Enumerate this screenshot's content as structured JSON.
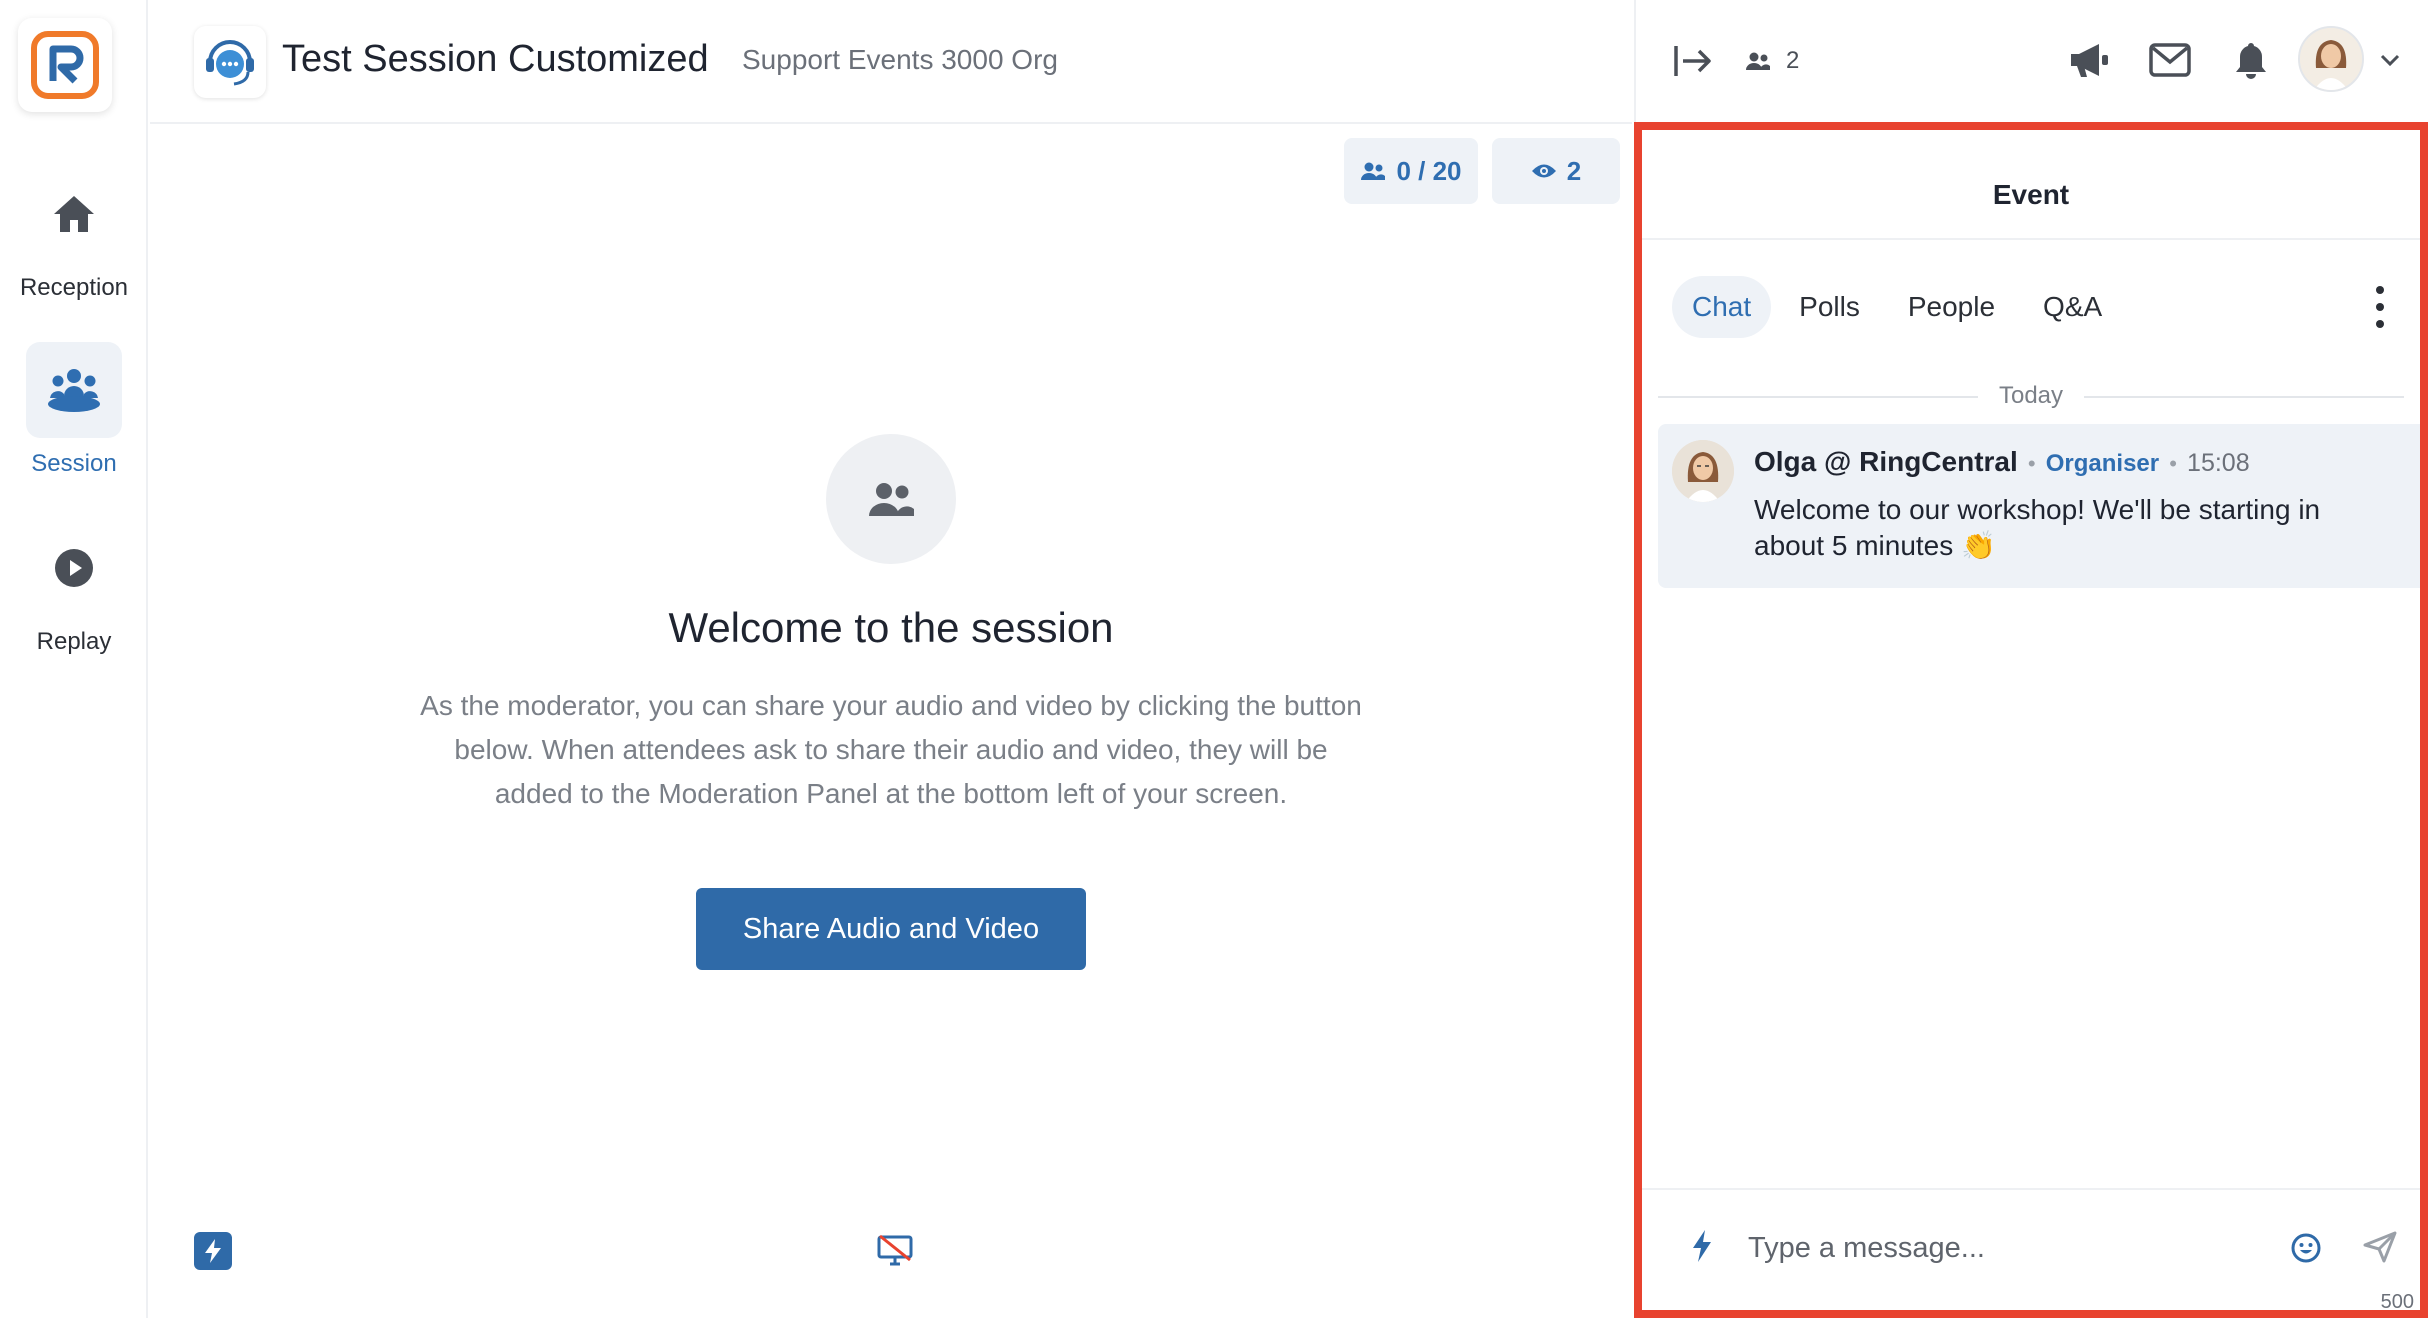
{
  "sidebar": {
    "items": [
      {
        "label": "Reception"
      },
      {
        "label": "Session"
      },
      {
        "label": "Replay"
      }
    ]
  },
  "header": {
    "title": "Test Session Customized",
    "org": "Support Events 3000 Org"
  },
  "stats": {
    "participants": "0 / 20",
    "viewers": "2"
  },
  "welcome": {
    "title": "Welcome to the session",
    "description": "As the moderator, you can share your audio and video by clicking the button below. When attendees ask to share their audio and video, they will be added to the Moderation Panel at the bottom left of your screen.",
    "button": "Share Audio and Video"
  },
  "topbar": {
    "attendee_count": "2"
  },
  "event_panel": {
    "title": "Event",
    "tabs": [
      {
        "label": "Chat",
        "active": true
      },
      {
        "label": "Polls",
        "active": false
      },
      {
        "label": "People",
        "active": false
      },
      {
        "label": "Q&A",
        "active": false
      }
    ],
    "day_divider": "Today",
    "messages": [
      {
        "author": "Olga @ RingCentral",
        "role": "Organiser",
        "time": "15:08",
        "text": "Welcome to our workshop! We'll be starting in about 5 minutes 👏"
      }
    ],
    "composer": {
      "placeholder": "Type a message...",
      "char_limit": "500"
    }
  },
  "colors": {
    "accent": "#2f6aa8",
    "highlight_border": "#e8432f",
    "brand_orange": "#f07a2a"
  }
}
